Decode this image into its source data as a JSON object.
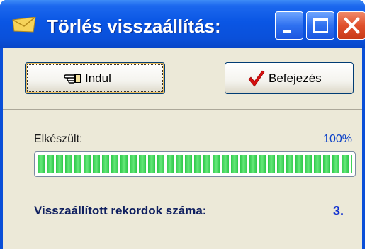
{
  "window": {
    "title": "Törlés visszaállítás:",
    "icon": "envelope-icon",
    "colors": {
      "titlebar": "#0a56e4",
      "client": "#ece9d8",
      "close": "#e0502c"
    }
  },
  "buttons": {
    "start": {
      "label": "Indul",
      "icon": "pointing-hand-icon"
    },
    "finish": {
      "label": "Befejezés",
      "icon": "checkmark-icon"
    }
  },
  "progress": {
    "label": "Elkészült:",
    "percent_text": "100%",
    "value": 100
  },
  "records": {
    "label": "Visszaállított rekordok száma:",
    "value": "3."
  }
}
